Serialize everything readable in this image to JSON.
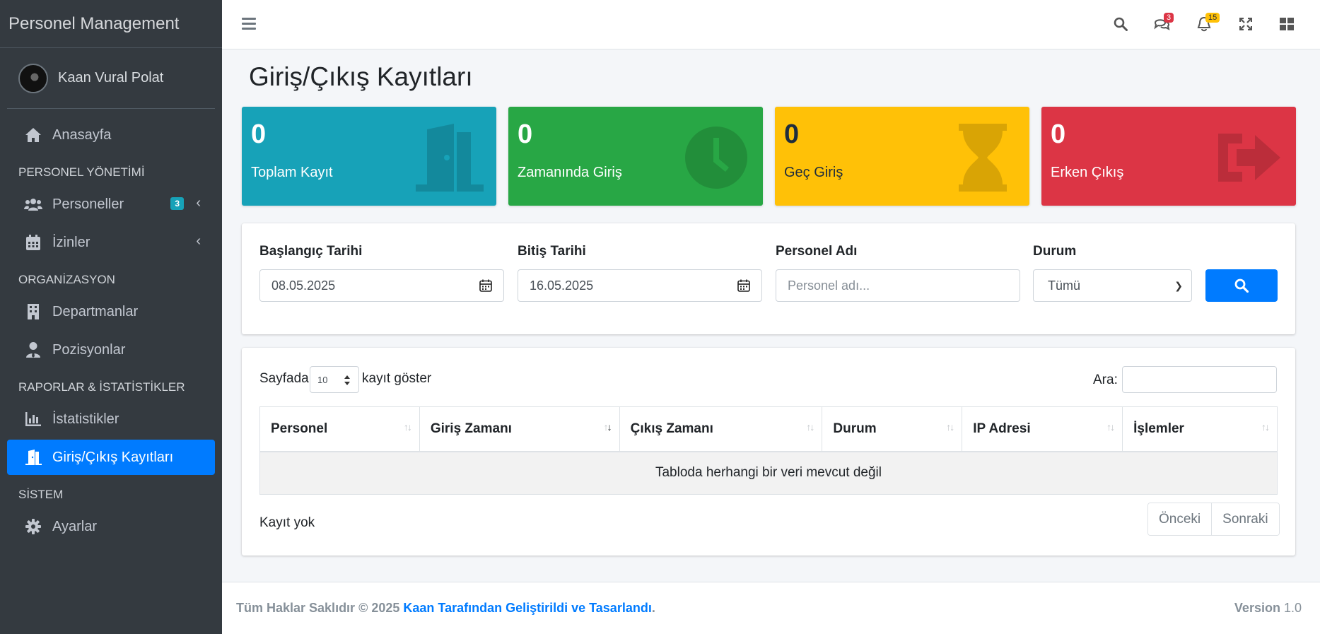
{
  "brand": "Personel Management",
  "user": {
    "name": "Kaan Vural Polat"
  },
  "sidebar": {
    "home": "Anasayfa",
    "section1": "PERSONEL YÖNETİMİ",
    "personeller": "Personeller",
    "personeller_badge": "3",
    "izinler": "İzinler",
    "section2": "ORGANİZASYON",
    "departmanlar": "Departmanlar",
    "pozisyonlar": "Pozisyonlar",
    "section3": "RAPORLAR & İSTATİSTİKLER",
    "istatistikler": "İstatistikler",
    "giris_cikis": "Giriş/Çıkış Kayıtları",
    "section4": "SİSTEM",
    "ayarlar": "Ayarlar"
  },
  "topbar": {
    "messages_badge": "3",
    "notifications_badge": "15"
  },
  "page": {
    "title": "Giriş/Çıkış Kayıtları"
  },
  "stats": [
    {
      "value": "0",
      "label": "Toplam Kayıt",
      "color": "#17a2b8",
      "icon": "door-open-icon"
    },
    {
      "value": "0",
      "label": "Zamanında Giriş",
      "color": "#28a745",
      "icon": "clock-icon"
    },
    {
      "value": "0",
      "label": "Geç Giriş",
      "color": "#ffc107",
      "icon": "hourglass-icon"
    },
    {
      "value": "0",
      "label": "Erken Çıkış",
      "color": "#dc3545",
      "icon": "sign-out-icon"
    }
  ],
  "filters": {
    "start_label": "Başlangıç Tarihi",
    "start_value": "08.05.2025",
    "end_label": "Bitiş Tarihi",
    "end_value": "16.05.2025",
    "name_label": "Personel Adı",
    "name_placeholder": "Personel adı...",
    "status_label": "Durum",
    "status_value": "Tümü"
  },
  "table": {
    "length_prefix": "Sayfada",
    "length_value": "10",
    "length_suffix": "kayıt göster",
    "search_label": "Ara:",
    "columns": [
      "Personel",
      "Giriş Zamanı",
      "Çıkış Zamanı",
      "Durum",
      "IP Adresi",
      "İşlemler"
    ],
    "empty": "Tabloda herhangi bir veri mevcut değil",
    "info": "Kayıt yok",
    "prev": "Önceki",
    "next": "Sonraki"
  },
  "footer": {
    "copyright": "Tüm Haklar Saklıdır © 2025",
    "author_link": "Kaan Tarafından Geliştirildi ve Tasarlandı",
    "period": ".",
    "version_label": "Version",
    "version_value": "1.0"
  }
}
